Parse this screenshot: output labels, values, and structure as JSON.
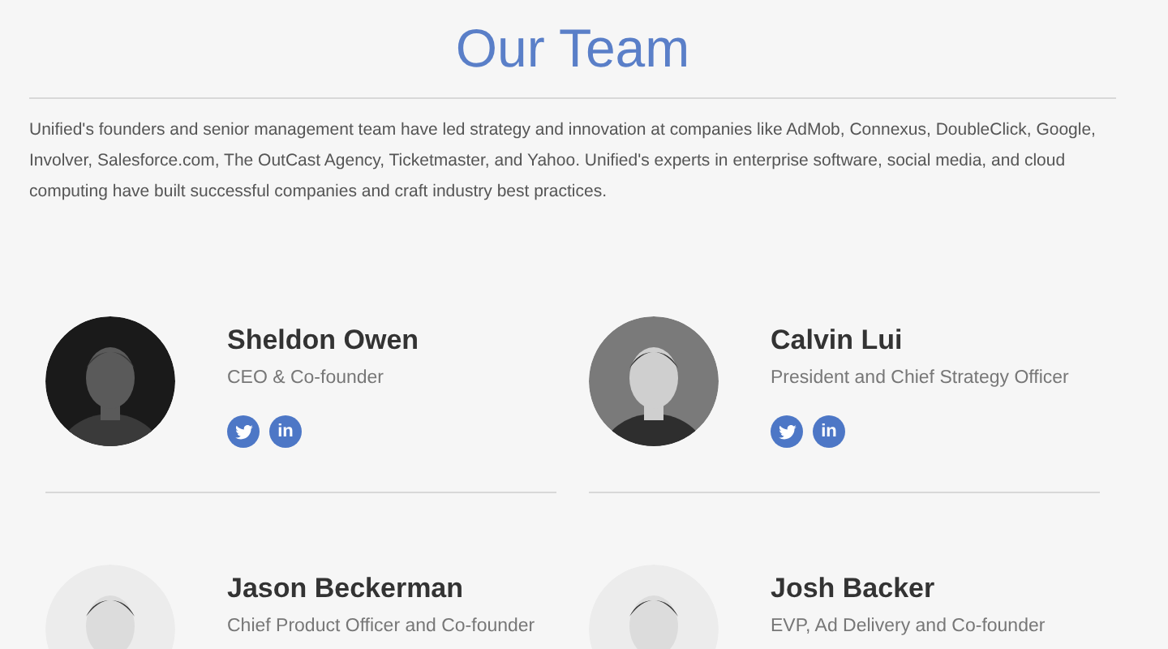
{
  "heading": "Our Team",
  "intro": "Unified's founders and senior management team have led strategy and innovation at companies like AdMob, Connexus, DoubleClick, Google, Involver, Salesforce.com, The OutCast Agency, Ticketmaster, and Yahoo. Unified's experts in enterprise software, social media, and cloud computing have built successful companies and craft industry best practices.",
  "members": [
    {
      "name": "Sheldon Owen",
      "title": "CEO & Co-founder",
      "social": [
        {
          "kind": "twitter"
        },
        {
          "kind": "linkedin",
          "label": "in"
        }
      ]
    },
    {
      "name": "Calvin Lui",
      "title": "President and Chief Strategy Officer",
      "social": [
        {
          "kind": "twitter"
        },
        {
          "kind": "linkedin",
          "label": "in"
        }
      ]
    },
    {
      "name": "Jason Beckerman",
      "title": "Chief Product Officer and Co-founder"
    },
    {
      "name": "Josh Backer",
      "title": "EVP, Ad Delivery and Co-founder"
    }
  ]
}
